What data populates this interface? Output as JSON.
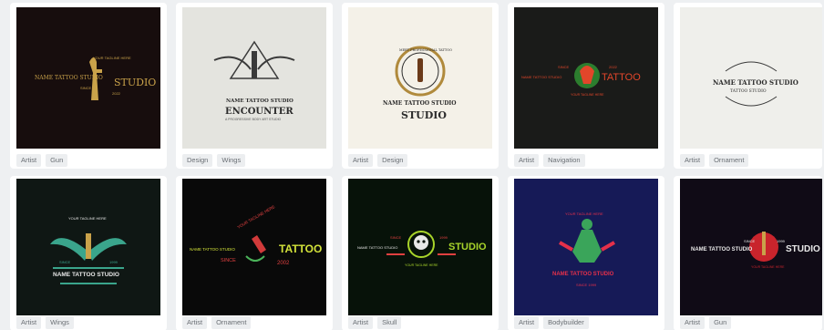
{
  "cards": [
    {
      "bg": "#170d0d",
      "texts": [
        "NAME TATTOO STUDIO",
        "YOUR TAGLINE HERE",
        "STUDIO",
        "SINCE",
        "2022"
      ],
      "tags": [
        "Artist",
        "Gun"
      ],
      "accent": "#c9a24a"
    },
    {
      "bg": "#e4e4df",
      "texts": [
        "NAME TATTOO STUDIO",
        "ENCOUNTER",
        "A PROGRESSIVE BODY ART STUDIO"
      ],
      "tags": [
        "Design",
        "Wings"
      ],
      "accent": "#2b2b2b"
    },
    {
      "bg": "#f4f1e8",
      "texts": [
        "MEET PROFESSIONAL TATTOO",
        "NAME TATTOO STUDIO",
        "STUDIO"
      ],
      "tags": [
        "Artist",
        "Design"
      ],
      "accent": "#b08a3c"
    },
    {
      "bg": "#1a1b19",
      "texts": [
        "SINCE",
        "2022",
        "NAME TATTOO STUDIO",
        "TATTOO",
        "YOUR TAGLINE HERE"
      ],
      "tags": [
        "Artist",
        "Navigation"
      ],
      "accent": "#e2462a"
    },
    {
      "bg": "#efefeb",
      "texts": [
        "NAME TATTOO STUDIO",
        "TATTOO STUDIO"
      ],
      "tags": [
        "Artist",
        "Ornament"
      ],
      "accent": "#2b2b2b"
    },
    {
      "bg": "#0f1714",
      "texts": [
        "YOUR TAGLINE HERE",
        "SINCE",
        "1999",
        "NAME TATTOO STUDIO"
      ],
      "tags": [
        "Artist",
        "Wings"
      ],
      "accent": "#3aa58c"
    },
    {
      "bg": "#090909",
      "texts": [
        "NAME TATTOO STUDIO",
        "YOUR TAGLINE HERE",
        "TATTOO",
        "SINCE",
        "2002"
      ],
      "tags": [
        "Artist",
        "Ornament"
      ],
      "accent": "#d4e33a"
    },
    {
      "bg": "#071209",
      "texts": [
        "SINCE",
        "1999",
        "NAME TATTOO STUDIO",
        "STUDIO",
        "YOUR TAGLINE HERE"
      ],
      "tags": [
        "Artist",
        "Skull"
      ],
      "accent": "#a8d42a"
    },
    {
      "bg": "#161a57",
      "texts": [
        "YOUR TAGLINE HERE",
        "NAME TATTOO STUDIO",
        "SINCE 1999"
      ],
      "tags": [
        "Artist",
        "Bodybuilder"
      ],
      "accent": "#e5304a"
    },
    {
      "bg": "#100b16",
      "texts": [
        "SINCE",
        "1999",
        "NAME TATTOO STUDIO",
        "STUDIO",
        "YOUR TAGLINE HERE"
      ],
      "tags": [
        "Artist",
        "Gun"
      ],
      "accent": "#c9242c"
    }
  ]
}
